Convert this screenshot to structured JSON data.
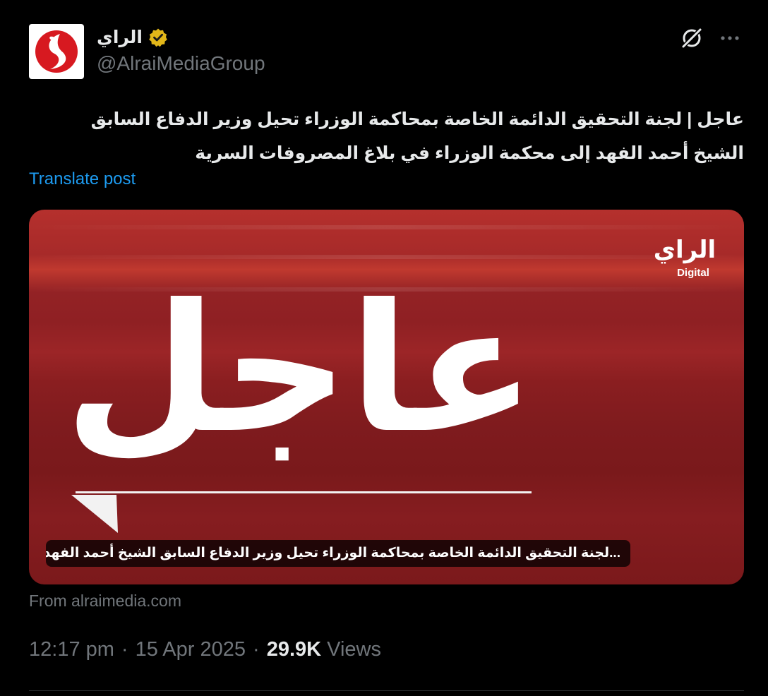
{
  "author": {
    "display_name": "الراي",
    "handle": "@AlraiMediaGroup",
    "verified_badge_color": "#e2b719",
    "avatar_icon": "alrai-logo-icon"
  },
  "actions": {
    "grok_icon": "grok-icon",
    "more_icon": "more-options-icon"
  },
  "post": {
    "text": "عاجل | لجنة التحقيق الدائمة الخاصة بمحاكمة الوزراء تحيل وزير الدفاع السابق الشيخ أحمد الفهد إلى محكمة الوزراء في بلاغ المصروفات السرية",
    "translate_label": "Translate post"
  },
  "card": {
    "headline_word": "عاجل",
    "brand_logo_text": "الراي",
    "brand_logo_subtext": "Digital",
    "caption": "...لجنة التحقيق الدائمة الخاصة بمحاكمة الوزراء تحيل وزير الدفاع السابق الشيخ أحمد الفهد إلى محكمة",
    "source": "From alraimedia.com",
    "accent_color": "#a8272a"
  },
  "meta": {
    "time": "12:17 pm",
    "separator": "·",
    "date": "15 Apr 2025",
    "views_count": "29.9K",
    "views_label": "Views"
  }
}
